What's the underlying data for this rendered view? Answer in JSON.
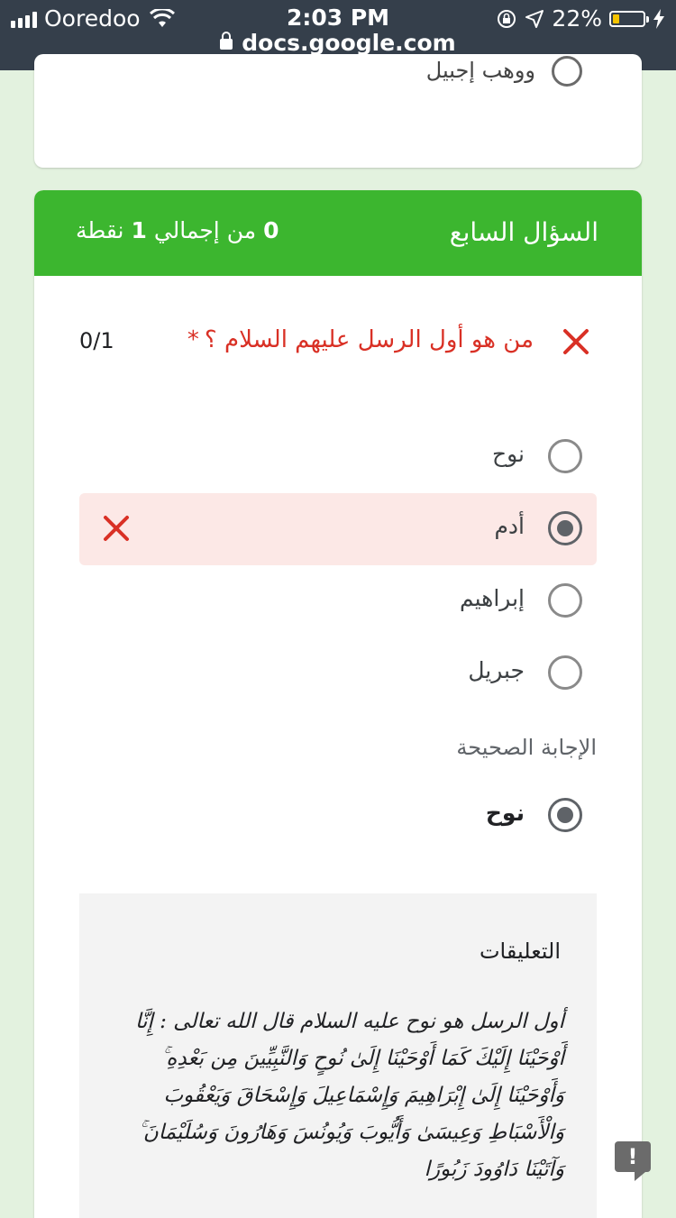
{
  "status_bar": {
    "carrier": "Ooredoo",
    "time": "2:03 PM",
    "url": "docs.google.com",
    "battery_percent": "22%",
    "battery_level": 0.22
  },
  "previous_card": {
    "option_fragment": "ووهب إجبيل"
  },
  "question": {
    "section_title": "السؤال السابع",
    "score_prefix": "0",
    "score_middle": "من إجمالي",
    "score_total": "1",
    "score_suffix": "نقطة",
    "text": "من هو أول الرسل عليهم السلام ؟",
    "required_mark": "*",
    "points": "0/1",
    "options": [
      {
        "label": "نوح",
        "selected": false,
        "wrong": false
      },
      {
        "label": "أدم",
        "selected": true,
        "wrong": true
      },
      {
        "label": "إبراهيم",
        "selected": false,
        "wrong": false
      },
      {
        "label": "جبريل",
        "selected": false,
        "wrong": false
      }
    ],
    "correct_answer_title": "الإجابة الصحيحة",
    "correct_answer": "نوح"
  },
  "feedback": {
    "title": "التعليقات",
    "lines": [
      "أول الرسل هو نوح عليه السلام قال الله تعالى : إِنَّا",
      "أَوْحَيْنَا إِلَيْكَ كَمَا أَوْحَيْنَا إِلَىٰ نُوحٍ وَالنَّبِيِّينَ مِن بَعْدِهِ ۚ",
      "وَأَوْحَيْنَا إِلَىٰ إِبْرَاهِيمَ وَإِسْمَاعِيلَ وَإِسْحَاقَ وَيَعْقُوبَ",
      "وَالْأَسْبَاطِ وَعِيسَىٰ وَأَيُّوبَ وَيُونُسَ وَهَارُونَ وَسُلَيْمَانَ ۚ",
      "وَآتَيْنَا دَاوُودَ زَبُورًا"
    ]
  },
  "report_button": {
    "label": "!"
  },
  "colors": {
    "header_green": "#3cb62f",
    "wrong_red": "#d93025",
    "wrong_bg": "#fce8e6",
    "status_bar": "#353f4b",
    "page_bg": "#e3f2df"
  }
}
